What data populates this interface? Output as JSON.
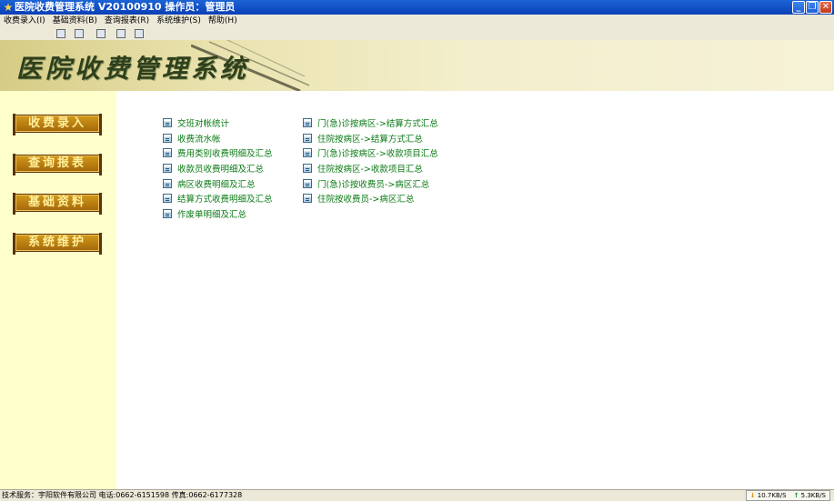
{
  "window": {
    "title": "医院收费管理系统 V20100910   操作员：管理员"
  },
  "menu": {
    "items": [
      "收费录入(I)",
      "基础资料(B)",
      "查询报表(R)",
      "系统维护(S)",
      "帮助(H)"
    ]
  },
  "banner": {
    "title": "医院收费管理系统"
  },
  "sidebar": {
    "buttons": [
      "收费录入",
      "查询报表",
      "基础资料",
      "系统维护"
    ]
  },
  "main": {
    "links_col1": [
      "交班对帐统计",
      "收费流水帐",
      "费用类别收费明细及汇总",
      "收款员收费明细及汇总",
      "病区收费明细及汇总",
      "结算方式收费明细及汇总",
      "作废单明细及汇总"
    ],
    "links_col2": [
      "门(急)诊按病区->结算方式汇总",
      "住院按病区->结算方式汇总",
      "门(急)诊按病区->收款项目汇总",
      "住院按病区->收款项目汇总",
      "门(急)诊按收费员->病区汇总",
      "住院按收费员->病区汇总"
    ]
  },
  "statusbar": {
    "text": "技术服务：宇阳软件有限公司  电话:0662-6151598  传真:0662-6177328",
    "download": "10.7KB/S",
    "upload": "5.3KB/S"
  },
  "colors": {
    "titlebar": "#0a3fb6",
    "link": "#0a7a14",
    "sidebar_bg": "#ffffcc",
    "nav_button": "#b8760e"
  }
}
